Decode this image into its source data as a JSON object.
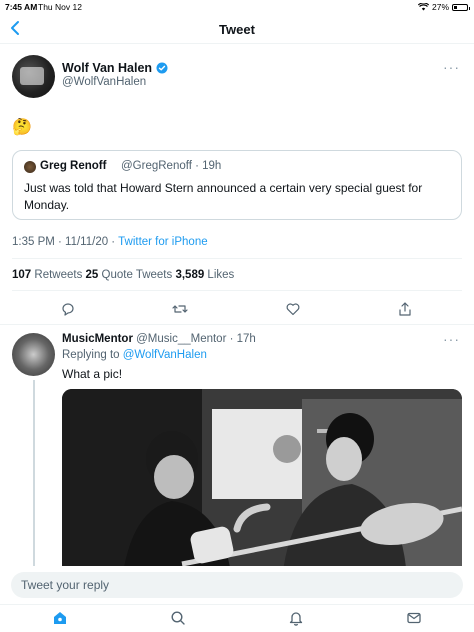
{
  "status": {
    "time": "7:45 AM",
    "date": "Thu Nov 12",
    "battery": "27%",
    "battery_level": 0.27
  },
  "nav": {
    "title": "Tweet"
  },
  "tweet": {
    "author_name": "Wolf Van Halen",
    "author_handle": "@WolfVanHalen",
    "text": "🤔",
    "quote": {
      "name": "Greg Renoff",
      "meta": "@GregRenoff · 19h",
      "text": "Just was told that Howard Stern announced a certain very special guest for Monday."
    },
    "time": "1:35 PM · 11/11/20 · ",
    "source": "Twitter for iPhone",
    "retweets_count": "107",
    "retweets_label": " Retweets  ",
    "quotes_count": "25",
    "quotes_label": " Quote Tweets  ",
    "likes_count": "3,589",
    "likes_label": " Likes"
  },
  "reply": {
    "name": "MusicMentor",
    "meta": " @Music__Mentor · 17h",
    "replying_prefix": "Replying to ",
    "replying_to": "@WolfVanHalen",
    "text": "What a pic!"
  },
  "composer": {
    "placeholder": "Tweet your reply"
  },
  "colors": {
    "accent": "#1d9bf0",
    "secondary_text": "#536471"
  }
}
